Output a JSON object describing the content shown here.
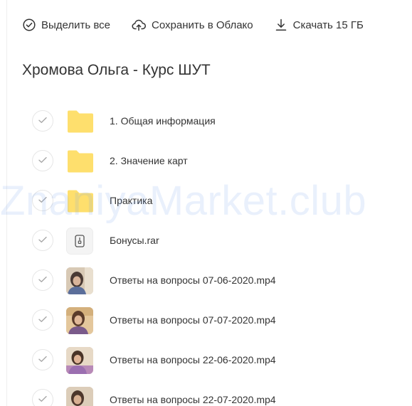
{
  "toolbar": {
    "select_all_label": "Выделить все",
    "save_to_cloud_label": "Сохранить в Облако",
    "download_label": "Скачать 15 ГБ"
  },
  "folder": {
    "title": "Хромова Ольга - Курс ШУТ"
  },
  "files": [
    {
      "name": "1. Общая информация",
      "type": "folder"
    },
    {
      "name": "2. Значение карт",
      "type": "folder"
    },
    {
      "name": "Практика",
      "type": "folder"
    },
    {
      "name": "Бонусы.rar",
      "type": "archive"
    },
    {
      "name": "Ответы на вопросы 07-06-2020.mp4",
      "type": "video"
    },
    {
      "name": "Ответы на вопросы 07-07-2020.mp4",
      "type": "video"
    },
    {
      "name": "Ответы на вопросы 22-06-2020.mp4",
      "type": "video"
    },
    {
      "name": "Ответы на вопросы 22-07-2020.mp4",
      "type": "video"
    }
  ],
  "watermark": "ZnaniyaMarket.club",
  "colors": {
    "folder": "#fedf6d",
    "text": "#333333",
    "checkmark": "#a8a8a8"
  },
  "icons": {
    "select_all": "check-circle-icon",
    "save_to_cloud": "cloud-upload-icon",
    "download": "download-icon",
    "row_check": "checkmark-icon",
    "folder": "folder-icon",
    "archive": "archive-icon",
    "video": "video-thumbnail"
  }
}
